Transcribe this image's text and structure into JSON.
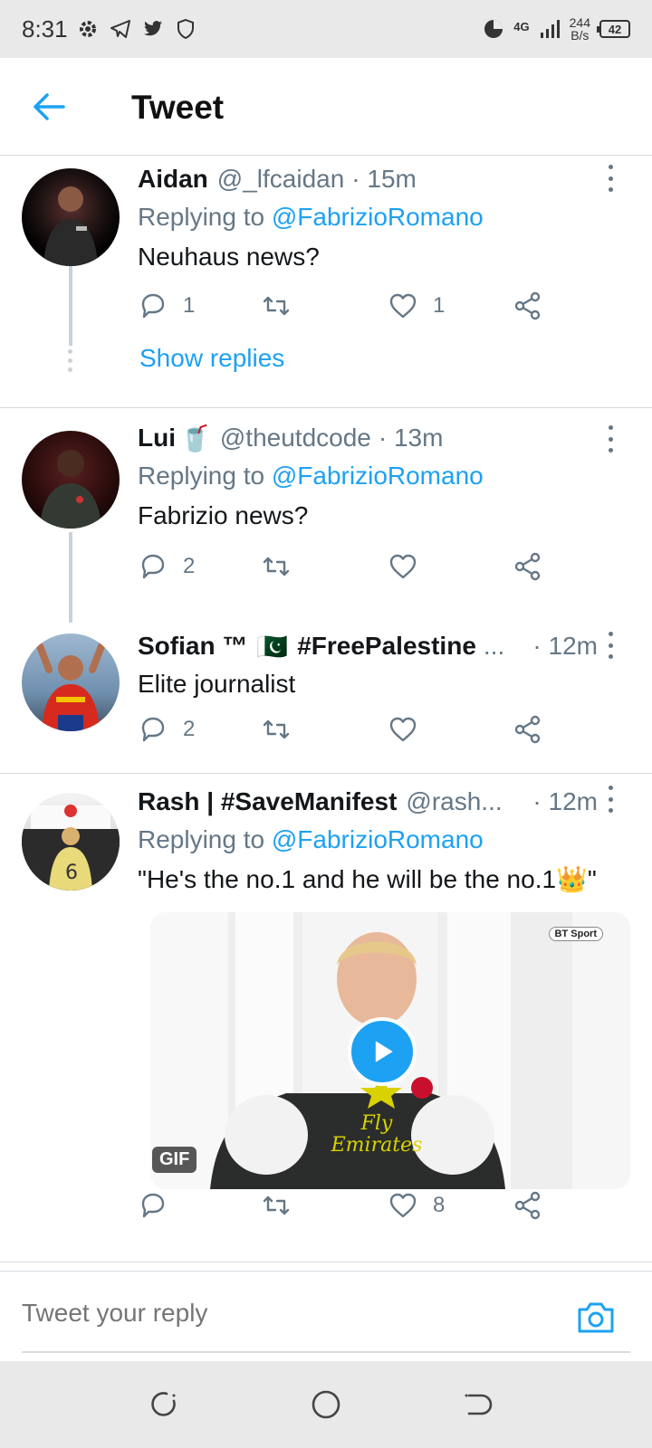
{
  "status_bar": {
    "time": "8:31",
    "network": "4G",
    "speed_value": "244",
    "speed_unit": "B/s",
    "battery": "42",
    "icons": [
      "gear-icon",
      "telegram-icon",
      "twitter-icon",
      "shield-icon",
      "data-saver-icon",
      "signal-icon"
    ]
  },
  "header": {
    "title": "Tweet"
  },
  "tweets": [
    {
      "name": "Aidan",
      "handle": "@_lfcaidan",
      "time": "· 15m",
      "replying_prefix": "Replying to",
      "replying_to": "@FabrizioRomano",
      "text": "Neuhaus news?",
      "replies": "1",
      "retweets": "",
      "likes": "1",
      "show_replies": "Show replies"
    },
    {
      "name": "Lui",
      "emoji": "🥤",
      "handle": "@theutdcode",
      "time": "· 13m",
      "replying_prefix": "Replying to",
      "replying_to": "@FabrizioRomano",
      "text": "Fabrizio news?",
      "replies": "2",
      "retweets": "",
      "likes": ""
    },
    {
      "name": "Sofian ™",
      "flag": "🇵🇰",
      "hashtag": "#FreePalestine",
      "ellipsis": "...",
      "time": "· 12m",
      "text": "Elite journalist",
      "replies": "2",
      "retweets": "",
      "likes": ""
    },
    {
      "name": "Rash | #SaveManifest",
      "handle": "@rash...",
      "time": "· 12m",
      "replying_prefix": "Replying to",
      "replying_to": "@FabrizioRomano",
      "text": "\"He's the no.1 and he will be the no.1👑\"",
      "media_badge": "GIF",
      "media_watermark": "BT Sport",
      "media_shirt_text": "Fly Emirates",
      "replies": "",
      "retweets": "",
      "likes": "8"
    }
  ],
  "reply_bar": {
    "placeholder": "Tweet your reply"
  },
  "colors": {
    "accent": "#1da1f2",
    "secondary_text": "#657786",
    "divider": "#d5dbe0"
  }
}
